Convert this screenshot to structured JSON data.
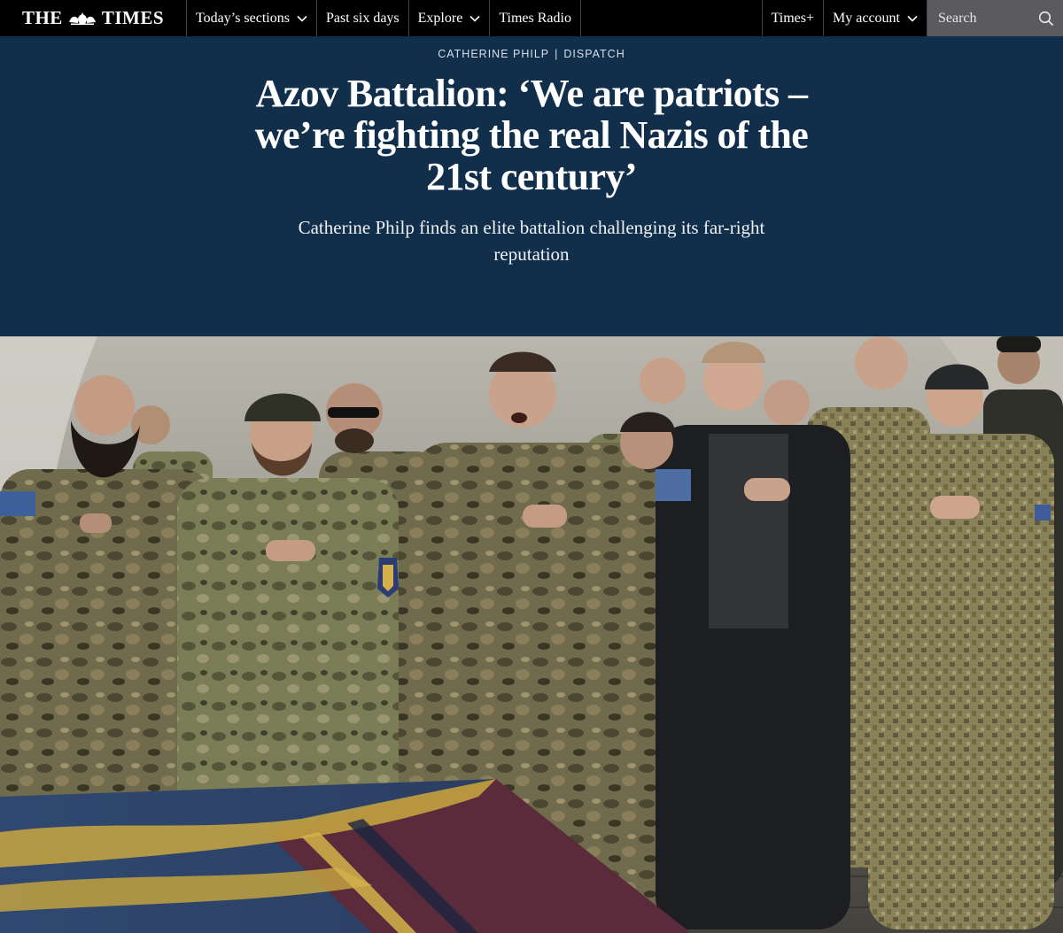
{
  "nav": {
    "logo_left": "THE",
    "logo_right": "TIMES",
    "items": [
      {
        "label": "Today’s sections",
        "has_dropdown": true
      },
      {
        "label": "Past six days",
        "has_dropdown": false
      },
      {
        "label": "Explore",
        "has_dropdown": true
      },
      {
        "label": "Times Radio",
        "has_dropdown": false
      }
    ],
    "right_items": [
      {
        "label": "Times+",
        "has_dropdown": false
      },
      {
        "label": "My account",
        "has_dropdown": true
      }
    ],
    "search_placeholder": "Search"
  },
  "article": {
    "author": "CATHERINE PHILP",
    "kicker_separator": "|",
    "section": "DISPATCH",
    "headline": "Azov Battalion: ‘We are patriots – we’re fighting the real Nazis of the 21st century’",
    "standfirst": "Catherine Philp finds an elite battalion challenging its far-right reputation"
  },
  "colors": {
    "nav_bg": "#000000",
    "header_bg": "#112e4b",
    "search_bg": "#5a5a5f"
  },
  "icons": {
    "search": "search-icon",
    "dropdown": "chevron-down-icon",
    "logo": "royal-crest-icon"
  }
}
